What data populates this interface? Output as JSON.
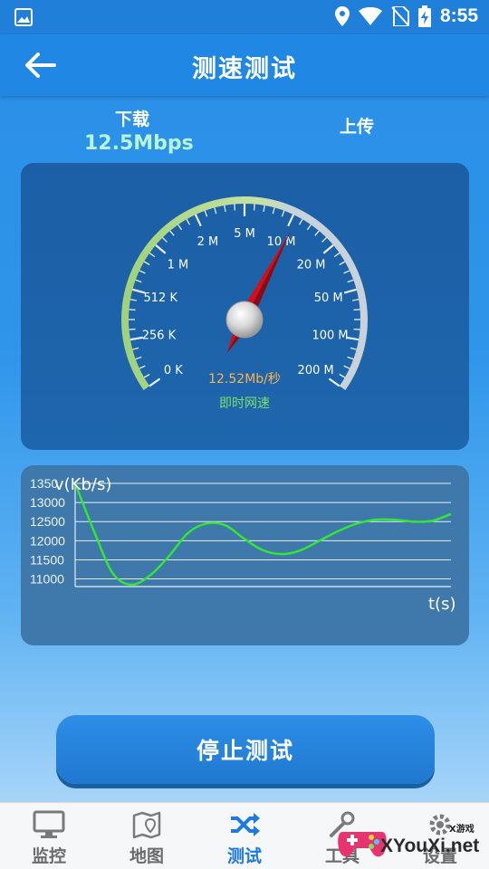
{
  "app_bar": {
    "title": "测速测试"
  },
  "status_bar": {
    "time": "8:55"
  },
  "speed": {
    "download_label": "下载",
    "download_value": "12.5Mbps",
    "upload_label": "上传"
  },
  "gauge": {
    "tick_labels": [
      "0 K",
      "256 K",
      "512 K",
      "1 M",
      "2 M",
      "5 M",
      "10 M",
      "20 M",
      "50 M",
      "100 M",
      "200 M"
    ],
    "current_speed": "12.52Mb/秒",
    "caption": "即时网速",
    "needle_level_step": 6.1
  },
  "chart_data": {
    "type": "line",
    "title": "",
    "ylabel": "v(Kb/s)",
    "xlabel": "t(s)",
    "yticks": [
      11000,
      11500,
      12000,
      12500,
      13000,
      13500
    ],
    "ytick_labels": [
      "11000",
      "11500",
      "12000",
      "12500",
      "13000",
      "1350"
    ],
    "ylim": [
      10800,
      13500
    ],
    "x": [
      0,
      1,
      2,
      3,
      4,
      5,
      6,
      7,
      8,
      9,
      10,
      11,
      12,
      13,
      14,
      15,
      16,
      17,
      18,
      19,
      20
    ],
    "values": [
      13500,
      12250,
      11150,
      10850,
      11100,
      11600,
      12200,
      12450,
      12400,
      12050,
      11750,
      11650,
      11750,
      12000,
      12250,
      12450,
      12550,
      12550,
      12500,
      12520,
      12700
    ],
    "grid": true,
    "line_color": "#33e633"
  },
  "actions": {
    "stop_label": "停止测试"
  },
  "nav": {
    "items": [
      {
        "label": "监控",
        "icon": "monitor-icon"
      },
      {
        "label": "地图",
        "icon": "map-icon"
      },
      {
        "label": "测试",
        "icon": "shuffle-icon"
      },
      {
        "label": "工具",
        "icon": "tools-icon"
      },
      {
        "label": "设置",
        "icon": "gear-icon"
      }
    ],
    "active_index": 2
  },
  "watermark": {
    "text": "XYouXi.net",
    "small": "X游戏"
  },
  "colors": {
    "primary": "#2187e4",
    "download_value": "#b6f5d6",
    "gauge_speed_text": "#ffb24a",
    "gauge_caption": "#7be06a",
    "chart_line": "#33e633",
    "nav_active": "#1c7ae0"
  }
}
